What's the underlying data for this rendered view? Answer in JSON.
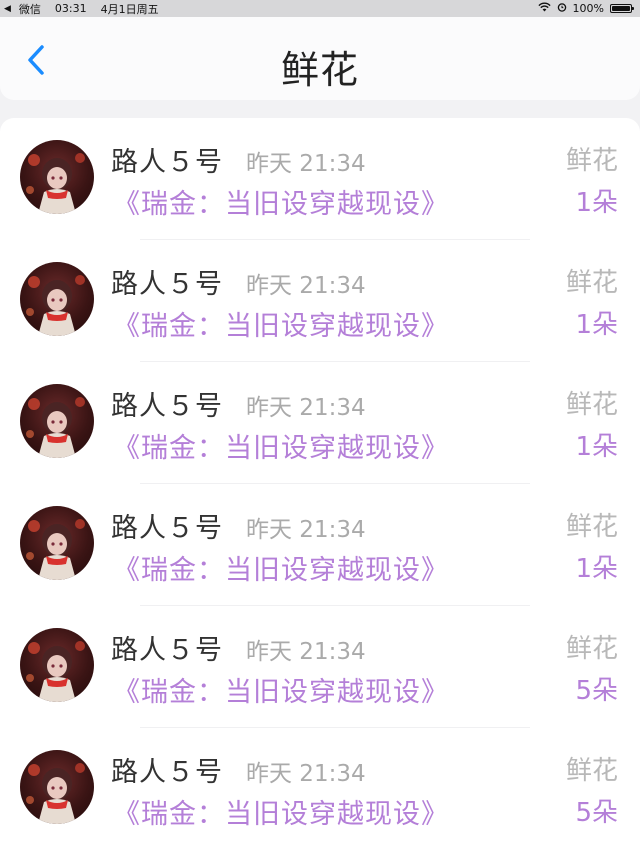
{
  "statusbar": {
    "back_app": "微信",
    "time": "03:31",
    "date": "4月1日周五",
    "battery": "100%",
    "icons": [
      "wifi-icon",
      "alarm-icon",
      "battery-icon"
    ]
  },
  "header": {
    "title": "鲜花",
    "back_icon": "chevron-left-icon"
  },
  "colors": {
    "accent_blue": "#1a8cff",
    "book_purple": "#b47fd8",
    "muted_gray": "#aaaaaa"
  },
  "items": [
    {
      "user": "路人５号",
      "time": "昨天 21:34",
      "book": "《瑞金：当旧设穿越现设》",
      "type": "鲜花",
      "count": "1朵"
    },
    {
      "user": "路人５号",
      "time": "昨天 21:34",
      "book": "《瑞金：当旧设穿越现设》",
      "type": "鲜花",
      "count": "1朵"
    },
    {
      "user": "路人５号",
      "time": "昨天 21:34",
      "book": "《瑞金：当旧设穿越现设》",
      "type": "鲜花",
      "count": "1朵"
    },
    {
      "user": "路人５号",
      "time": "昨天 21:34",
      "book": "《瑞金：当旧设穿越现设》",
      "type": "鲜花",
      "count": "1朵"
    },
    {
      "user": "路人５号",
      "time": "昨天 21:34",
      "book": "《瑞金：当旧设穿越现设》",
      "type": "鲜花",
      "count": "5朵"
    },
    {
      "user": "路人５号",
      "time": "昨天 21:34",
      "book": "《瑞金：当旧设穿越现设》",
      "type": "鲜花",
      "count": "5朵"
    }
  ]
}
